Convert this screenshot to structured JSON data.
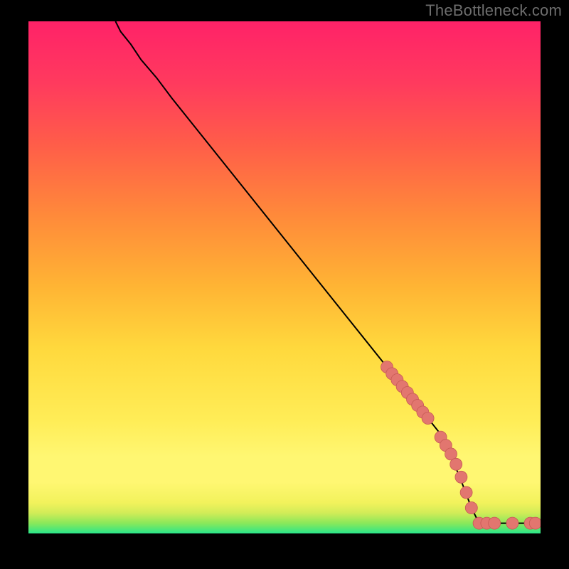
{
  "attribution": "TheBottleneck.com",
  "colors": {
    "marker_fill": "#e2766f",
    "marker_stroke": "#c65a54",
    "curve_stroke": "#000000"
  },
  "chart_data": {
    "type": "line",
    "title": "",
    "xlabel": "",
    "ylabel": "",
    "xlim": [
      0,
      100
    ],
    "ylim": [
      0,
      100
    ],
    "curve": {
      "x": [
        17,
        18,
        20,
        22,
        25,
        28,
        32,
        40,
        50,
        60,
        70,
        76,
        80,
        83,
        85,
        86.5,
        88
      ],
      "y": [
        100,
        98,
        95.5,
        92.5,
        89,
        85,
        80,
        70,
        57.5,
        45,
        32.5,
        25,
        20,
        14,
        9,
        5,
        2
      ]
    },
    "flat_line": {
      "x_start": 88,
      "x_end": 100,
      "y": 2
    },
    "markers": [
      {
        "x": 70.0,
        "y": 32.5
      },
      {
        "x": 71.0,
        "y": 31.2
      },
      {
        "x": 72.0,
        "y": 30.0
      },
      {
        "x": 73.0,
        "y": 28.7
      },
      {
        "x": 74.0,
        "y": 27.5
      },
      {
        "x": 75.0,
        "y": 26.2
      },
      {
        "x": 76.0,
        "y": 25.0
      },
      {
        "x": 77.0,
        "y": 23.7
      },
      {
        "x": 78.0,
        "y": 22.5
      },
      {
        "x": 80.5,
        "y": 18.8
      },
      {
        "x": 81.5,
        "y": 17.2
      },
      {
        "x": 82.5,
        "y": 15.5
      },
      {
        "x": 83.5,
        "y": 13.5
      },
      {
        "x": 84.5,
        "y": 11.0
      },
      {
        "x": 85.5,
        "y": 8.0
      },
      {
        "x": 86.5,
        "y": 5.0
      },
      {
        "x": 88.0,
        "y": 2.0
      },
      {
        "x": 89.5,
        "y": 2.0
      },
      {
        "x": 91.0,
        "y": 2.0
      },
      {
        "x": 94.5,
        "y": 2.0
      },
      {
        "x": 98.0,
        "y": 2.0
      },
      {
        "x": 99.0,
        "y": 2.0
      }
    ]
  }
}
